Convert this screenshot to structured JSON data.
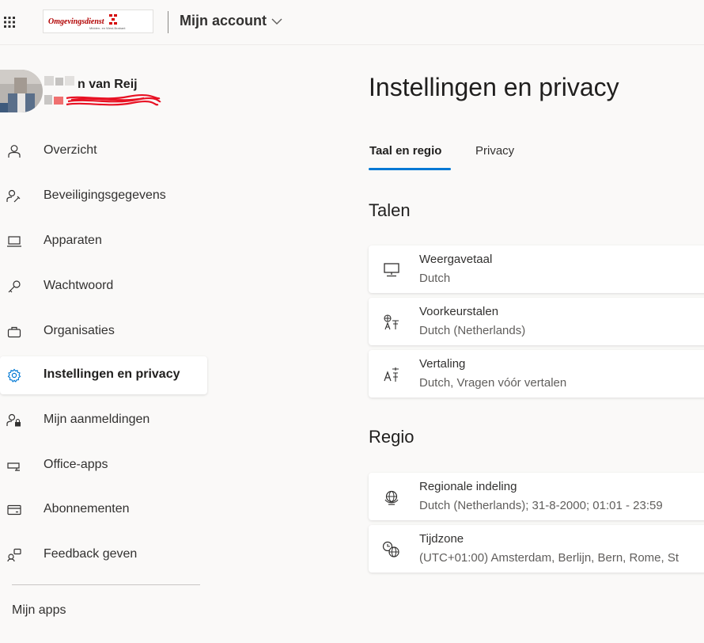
{
  "header": {
    "logo_text": "Omgevingsdienst",
    "logo_subtext": "Midden- en West-Brabant",
    "account_menu_label": "Mijn account"
  },
  "profile": {
    "name": "n van Reij"
  },
  "sidebar": {
    "items": [
      {
        "label": "Overzicht",
        "icon": "person-icon"
      },
      {
        "label": "Beveiligingsgegevens",
        "icon": "person-key-icon"
      },
      {
        "label": "Apparaten",
        "icon": "laptop-icon"
      },
      {
        "label": "Wachtwoord",
        "icon": "key-icon"
      },
      {
        "label": "Organisaties",
        "icon": "briefcase-icon"
      },
      {
        "label": "Instellingen en privacy",
        "icon": "gear-icon",
        "active": true
      },
      {
        "label": "Mijn aanmeldingen",
        "icon": "person-lock-icon"
      },
      {
        "label": "Office-apps",
        "icon": "office-apps-icon"
      },
      {
        "label": "Abonnementen",
        "icon": "card-icon"
      },
      {
        "label": "Feedback geven",
        "icon": "feedback-icon"
      }
    ],
    "my_apps_label": "Mijn apps"
  },
  "main": {
    "title": "Instellingen en privacy",
    "tabs": [
      {
        "label": "Taal en regio",
        "active": true
      },
      {
        "label": "Privacy",
        "active": false
      }
    ],
    "sections": [
      {
        "title": "Talen",
        "cards": [
          {
            "title": "Weergavetaal",
            "value": "Dutch",
            "icon": "monitor-icon"
          },
          {
            "title": "Voorkeurstalen",
            "value": "Dutch (Netherlands)",
            "icon": "language-icon"
          },
          {
            "title": "Vertaling",
            "value": "Dutch, Vragen vóór vertalen",
            "icon": "translate-icon"
          }
        ]
      },
      {
        "title": "Regio",
        "cards": [
          {
            "title": "Regionale indeling",
            "value": "Dutch (Netherlands); 31-8-2000; 01:01 - 23:59",
            "icon": "globe-settings-icon"
          },
          {
            "title": "Tijdzone",
            "value": "(UTC+01:00) Amsterdam, Berlijn, Bern, Rome, St",
            "icon": "globe-clock-icon"
          }
        ]
      }
    ]
  },
  "colors": {
    "accent": "#0078d4",
    "background": "#faf9f8",
    "card": "#ffffff",
    "text": "#323130"
  }
}
